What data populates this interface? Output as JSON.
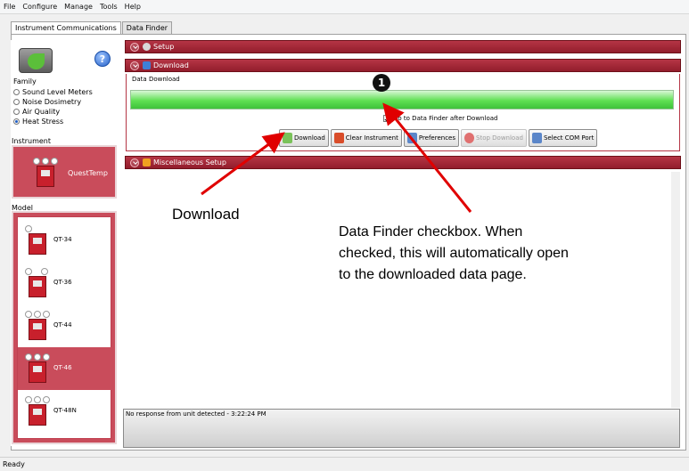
{
  "menu": {
    "file": "File",
    "configure": "Configure",
    "manage": "Manage",
    "tools": "Tools",
    "help": "Help"
  },
  "tabs": {
    "instrument": "Instrument Communications",
    "data_finder": "Data Finder"
  },
  "left": {
    "help_glyph": "?",
    "family_label": "Family",
    "family_options": [
      "Sound Level Meters",
      "Noise Dosimetry",
      "Air Quality",
      "Heat Stress"
    ],
    "family_selected": "Heat Stress",
    "instrument_label": "Instrument",
    "instrument_name": "QuestTemp",
    "model_label": "Model",
    "models": [
      "QT-34",
      "QT-36",
      "QT-44",
      "QT-46",
      "QT-48N"
    ],
    "selected_model": "QT-46"
  },
  "sections": {
    "setup": "Setup",
    "download": "Download",
    "misc": "Miscellaneous Setup"
  },
  "download": {
    "data_download_label": "Data Download",
    "progress_percent": 100,
    "checkbox_label": "Go to Data Finder after Download",
    "checkbox_checked": true,
    "buttons": {
      "download": "Download",
      "clear": "Clear Instrument",
      "preferences": "Preferences",
      "stop": "Stop Download",
      "com": "Select COM Port"
    }
  },
  "status": {
    "message": "No response from unit detected - 3:22:24 PM",
    "statusbar": "Ready"
  },
  "annotations": {
    "bubble": "1",
    "download_callout": "Download",
    "data_finder_callout": "Data Finder checkbox. When checked, this will automatically open to the downloaded data page."
  },
  "colors": {
    "accent": "#b53545",
    "progress": "#5fe052",
    "selected": "#c94c5b"
  },
  "icons": {
    "app_logo": "app-logo-icon",
    "help": "help-icon",
    "setup": "gear-icon",
    "download": "download-icon",
    "misc": "folder-icon",
    "stop": "stop-icon"
  }
}
